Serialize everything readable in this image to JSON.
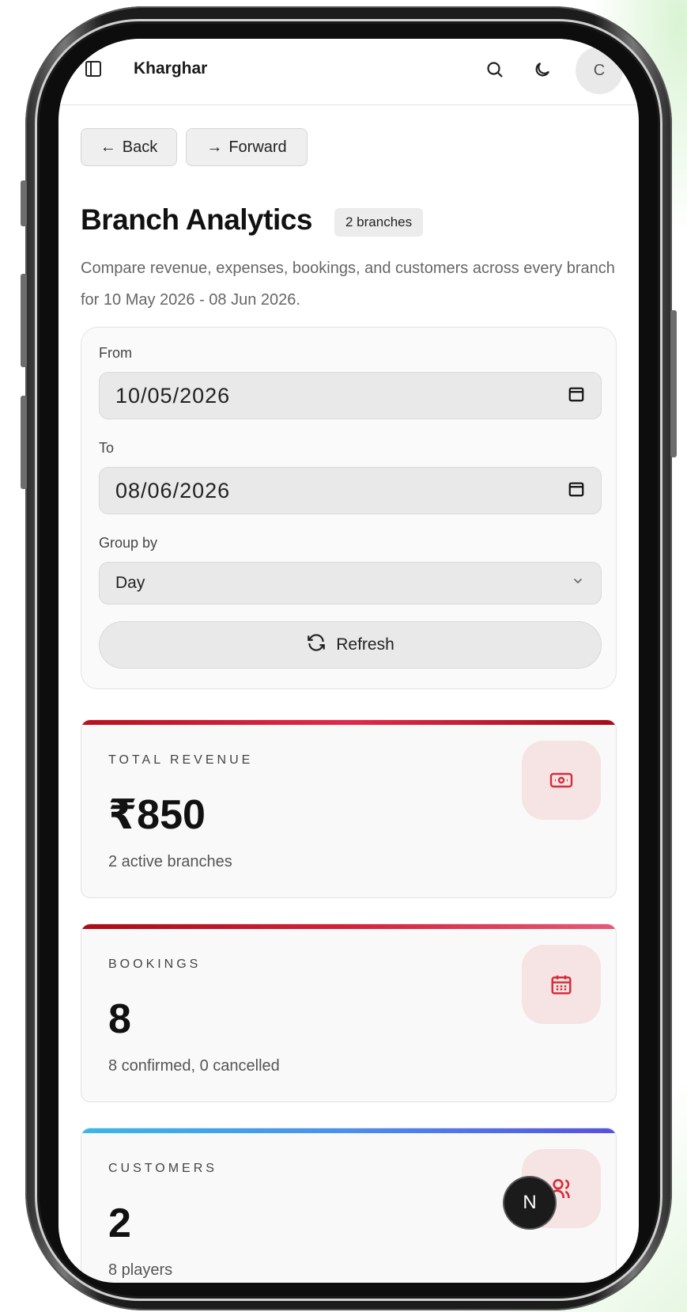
{
  "header": {
    "branch_name": "Kharghar",
    "avatar_initial": "C",
    "icons": [
      "sidebar-toggle-icon",
      "search-icon",
      "moon-icon"
    ]
  },
  "nav": {
    "back_label": "Back",
    "forward_label": "Forward"
  },
  "page": {
    "title": "Branch Analytics",
    "badge": "2 branches",
    "description": "Compare revenue, expenses, bookings, and customers across every branch for 10 May 2026 - 08 Jun 2026."
  },
  "filters": {
    "from_label": "From",
    "from_value": "10/05/2026",
    "to_label": "To",
    "to_value": "08/06/2026",
    "group_label": "Group by",
    "group_value": "Day",
    "refresh_label": "Refresh"
  },
  "stats": [
    {
      "label": "TOTAL REVENUE",
      "value": "₹850",
      "sub": "2 active branches",
      "icon": "banknote-icon"
    },
    {
      "label": "BOOKINGS",
      "value": "8",
      "sub": "8 confirmed, 0 cancelled",
      "icon": "calendar-icon"
    },
    {
      "label": "CUSTOMERS",
      "value": "2",
      "sub": "8 players",
      "icon": "users-icon"
    }
  ],
  "dev_badge": "N",
  "colors": {
    "revenue_bar": "#c2182b",
    "bookings_bar": "#c2182b",
    "customers_bar": "#4b6fe8",
    "icon_accent": "#d32f3a"
  }
}
